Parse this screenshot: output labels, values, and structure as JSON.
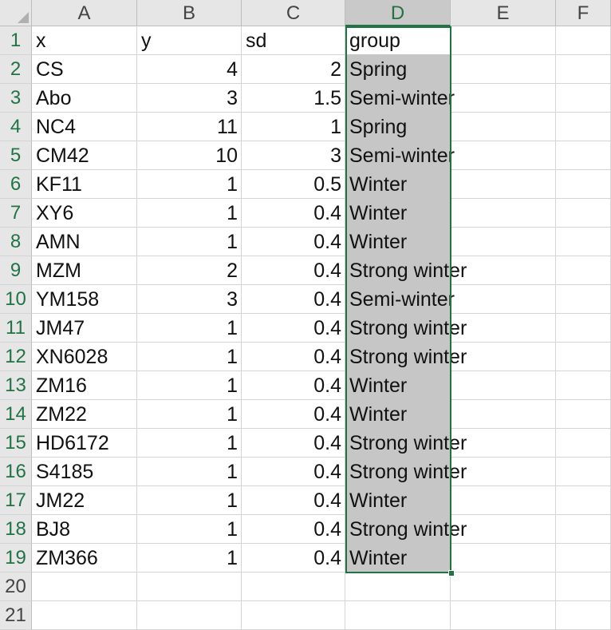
{
  "columns": [
    "A",
    "B",
    "C",
    "D",
    "E",
    "F"
  ],
  "active_column": "D",
  "row_numbers": [
    "1",
    "2",
    "3",
    "4",
    "5",
    "6",
    "7",
    "8",
    "9",
    "10",
    "11",
    "12",
    "13",
    "14",
    "15",
    "16",
    "17",
    "18",
    "19",
    "20",
    "21"
  ],
  "header_row": [
    "x",
    "y",
    "sd",
    "group"
  ],
  "rows": [
    {
      "x": "CS",
      "y": "4",
      "sd": "2",
      "group": "Spring"
    },
    {
      "x": "Abo",
      "y": "3",
      "sd": "1.5",
      "group": "Semi-winter"
    },
    {
      "x": "NC4",
      "y": "11",
      "sd": "1",
      "group": "Spring"
    },
    {
      "x": "CM42",
      "y": "10",
      "sd": "3",
      "group": "Semi-winter"
    },
    {
      "x": "KF11",
      "y": "1",
      "sd": "0.5",
      "group": "Winter"
    },
    {
      "x": "XY6",
      "y": "1",
      "sd": "0.4",
      "group": "Winter"
    },
    {
      "x": "AMN",
      "y": "1",
      "sd": "0.4",
      "group": "Winter"
    },
    {
      "x": "MZM",
      "y": "2",
      "sd": "0.4",
      "group": "Strong winter"
    },
    {
      "x": "YM158",
      "y": "3",
      "sd": "0.4",
      "group": "Semi-winter"
    },
    {
      "x": "JM47",
      "y": "1",
      "sd": "0.4",
      "group": "Strong winter"
    },
    {
      "x": "XN6028",
      "y": "1",
      "sd": "0.4",
      "group": "Strong winter"
    },
    {
      "x": "ZM16",
      "y": "1",
      "sd": "0.4",
      "group": "Winter"
    },
    {
      "x": "ZM22",
      "y": "1",
      "sd": "0.4",
      "group": "Winter"
    },
    {
      "x": "HD6172",
      "y": "1",
      "sd": "0.4",
      "group": "Strong winter"
    },
    {
      "x": "S4185",
      "y": "1",
      "sd": "0.4",
      "group": "Strong winter"
    },
    {
      "x": "JM22",
      "y": "1",
      "sd": "0.4",
      "group": "Winter"
    },
    {
      "x": "BJ8",
      "y": "1",
      "sd": "0.4",
      "group": "Strong winter"
    },
    {
      "x": "ZM366",
      "y": "1",
      "sd": "0.4",
      "group": "Winter"
    }
  ],
  "colors": {
    "accent": "#217346",
    "header_bg": "#e6e6e6",
    "selection_fill": "#c6c6c6"
  }
}
